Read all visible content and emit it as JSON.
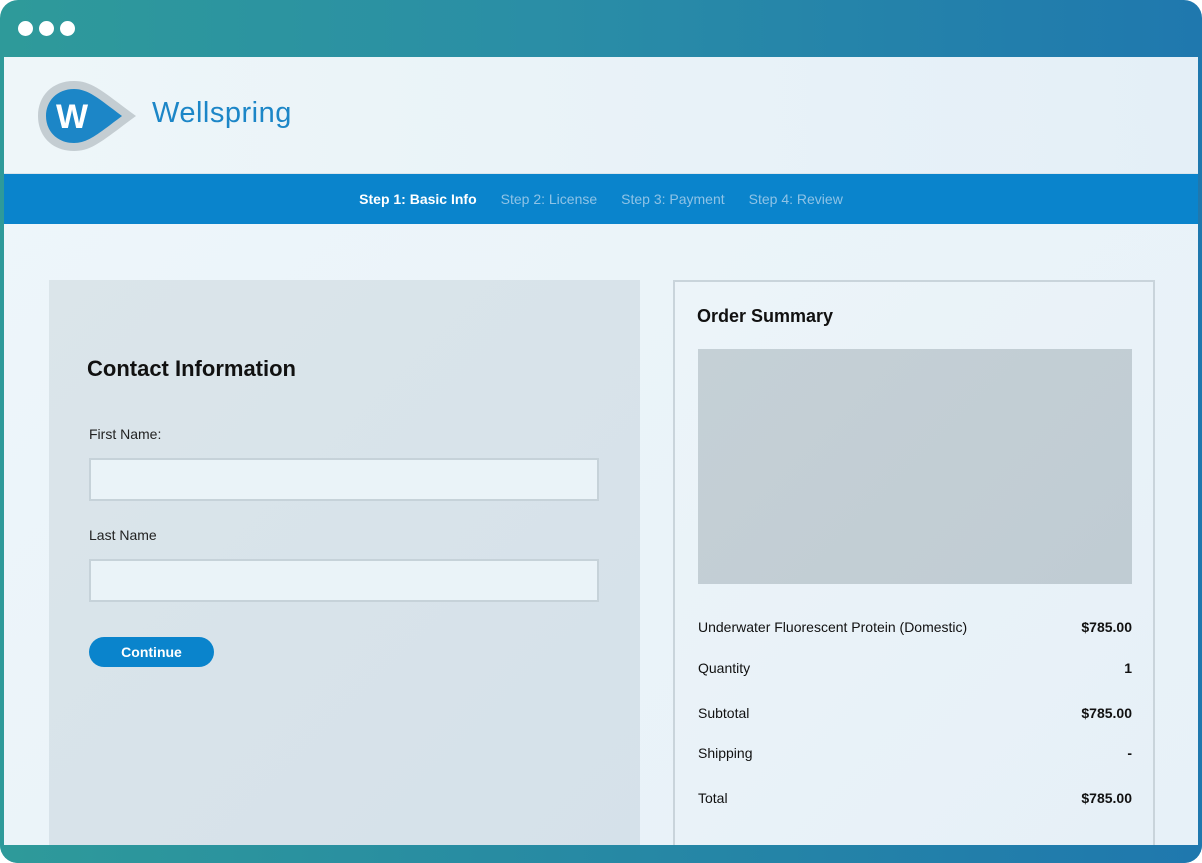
{
  "browser": {
    "window_controls": [
      "dot",
      "dot",
      "dot"
    ]
  },
  "header": {
    "brand_name": "Wellspring",
    "logo_letter": "W",
    "colors": {
      "brand": "#1c86c7",
      "accent": "#0a84cc"
    }
  },
  "steps": [
    {
      "label": "Step 1: Basic Info",
      "active": true
    },
    {
      "label": "Step 2: License",
      "active": false
    },
    {
      "label": "Step 3: Payment",
      "active": false
    },
    {
      "label": "Step 4: Review",
      "active": false
    }
  ],
  "contact": {
    "title": "Contact Information",
    "first_name_label": "First Name:",
    "first_name_value": "",
    "last_name_label": "Last Name",
    "last_name_value": "",
    "continue_label": "Continue"
  },
  "order": {
    "title": "Order Summary",
    "product_name": "Underwater Fluorescent Protein (Domestic)",
    "product_price": "$785.00",
    "quantity_label": "Quantity",
    "quantity_value": "1",
    "subtotal_label": "Subtotal",
    "subtotal_value": "$785.00",
    "shipping_label": "Shipping",
    "shipping_value": "-",
    "total_label": "Total",
    "total_value": "$785.00"
  }
}
